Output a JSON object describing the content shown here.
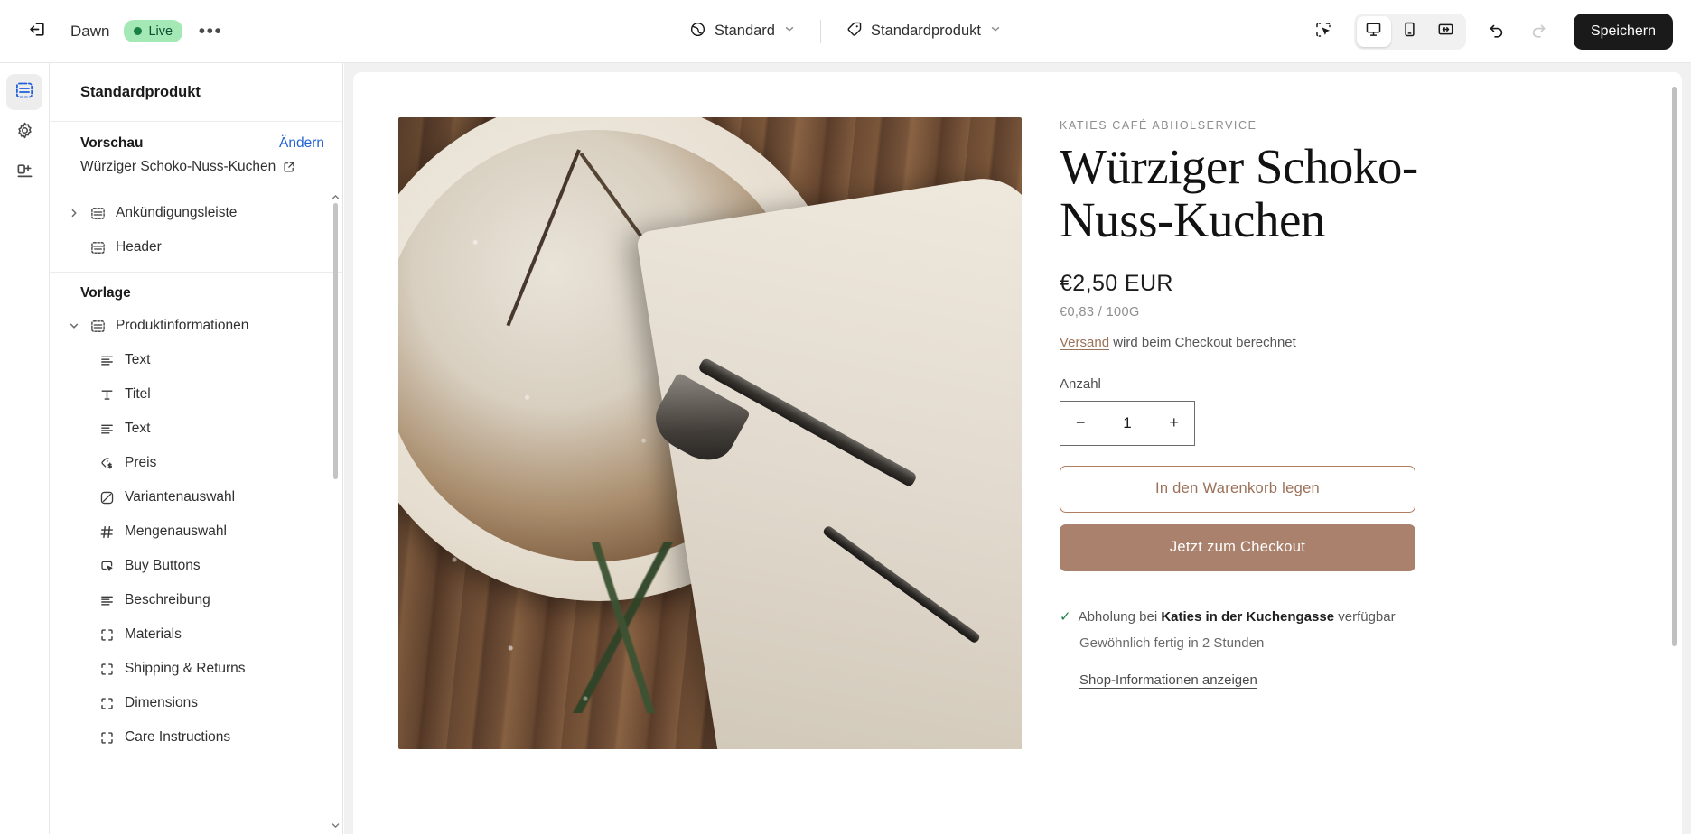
{
  "topbar": {
    "exit_icon": "exit-icon",
    "theme_name": "Dawn",
    "status_badge": "Live",
    "more_label": "•••",
    "locale_selector": {
      "icon": "globe-icon",
      "label": "Standard"
    },
    "template_selector": {
      "icon": "tag-icon",
      "label": "Standardprodukt"
    },
    "inspector_icon": "select-inspect-icon",
    "devices": [
      {
        "name": "desktop-icon",
        "active": true
      },
      {
        "name": "mobile-icon",
        "active": false
      },
      {
        "name": "fullscreen-icon",
        "active": false
      }
    ],
    "undo_icon": "undo-icon",
    "redo_icon": "redo-icon",
    "save_label": "Speichern"
  },
  "rail": [
    {
      "name": "sections-icon",
      "active": true
    },
    {
      "name": "settings-gear-icon",
      "active": false
    },
    {
      "name": "apps-icon",
      "active": false
    }
  ],
  "sidebar": {
    "title": "Standardprodukt",
    "preview_label": "Vorschau",
    "change_label": "Ändern",
    "preview_value": "Würziger Schoko-Nuss-Kuchen",
    "template_heading": "Vorlage",
    "top_items": [
      {
        "label": "Ankündigungsleiste",
        "icon": "section-icon",
        "caret": "chevron-right-icon",
        "indent": false
      },
      {
        "label": "Header",
        "icon": "header-icon",
        "caret": "",
        "indent": false
      }
    ],
    "section_root": {
      "label": "Produktinformationen",
      "icon": "section-icon",
      "caret": "chevron-down-icon"
    },
    "blocks": [
      {
        "label": "Text",
        "icon": "text-lines-icon"
      },
      {
        "label": "Titel",
        "icon": "title-t-icon"
      },
      {
        "label": "Text",
        "icon": "text-lines-icon"
      },
      {
        "label": "Preis",
        "icon": "price-tag-icon"
      },
      {
        "label": "Variantenauswahl",
        "icon": "variant-picker-icon"
      },
      {
        "label": "Mengenauswahl",
        "icon": "hash-icon"
      },
      {
        "label": "Buy Buttons",
        "icon": "buy-button-icon"
      },
      {
        "label": "Beschreibung",
        "icon": "text-lines-icon"
      },
      {
        "label": "Materials",
        "icon": "block-brackets-icon"
      },
      {
        "label": "Shipping & Returns",
        "icon": "block-brackets-icon"
      },
      {
        "label": "Dimensions",
        "icon": "block-brackets-icon"
      },
      {
        "label": "Care Instructions",
        "icon": "block-brackets-icon"
      }
    ]
  },
  "product": {
    "vendor": "KATIES CAFÉ ABHOLSERVICE",
    "title": "Würziger Schoko-Nuss-Kuchen",
    "price": "€2,50 EUR",
    "unit_price": "€0,83 / 100G",
    "shipping_link": "Versand",
    "shipping_rest": " wird beim Checkout berechnet",
    "quantity_label": "Anzahl",
    "quantity_minus": "−",
    "quantity_value": "1",
    "quantity_plus": "+",
    "add_to_cart": "In den Warenkorb legen",
    "checkout": "Jetzt zum Checkout",
    "pickup_check": "✓",
    "pickup_prefix": "Abholung bei ",
    "pickup_store": "Katies in der Kuchengasse",
    "pickup_suffix": " verfügbar",
    "pickup_time": "Gewöhnlich fertig in 2 Stunden",
    "pickup_more": "Shop-Informationen anzeigen"
  },
  "colors": {
    "accent_brown": "#a9816c",
    "link_brown": "#9b7257",
    "blue": "#1f5eda",
    "live_green_bg": "#a4e8b6",
    "live_green_text": "#0c5132"
  }
}
